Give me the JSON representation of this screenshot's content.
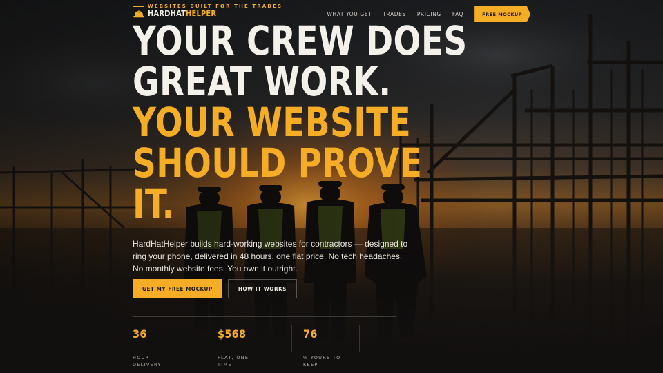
{
  "header": {
    "tagline": "WEBSITES BUILT FOR THE TRADES",
    "brand_primary": "HARDHAT",
    "brand_accent": "HELPER",
    "logo_icon": "hard-hat-icon",
    "nav": [
      {
        "label": "WHAT YOU GET"
      },
      {
        "label": "TRADES"
      },
      {
        "label": "PRICING"
      },
      {
        "label": "FAQ"
      }
    ],
    "cta_label": "FREE MOCKUP"
  },
  "hero": {
    "headline_white": [
      "YOUR CREW DOES",
      "GREAT WORK."
    ],
    "headline_accent": [
      "YOUR WEBSITE",
      "SHOULD PROVE",
      "IT."
    ],
    "lede": "HardHatHelper builds hard-working websites for contractors — designed to ring your phone, delivered in 48 hours, one flat price. No tech headaches. No monthly website fees. You own it outright.",
    "primary_button": "GET MY FREE MOCKUP",
    "secondary_button": "HOW IT WORKS"
  },
  "stats": [
    {
      "value": "36",
      "label": "HOUR DELIVERY"
    },
    {
      "value": "$568",
      "label": "FLAT, ONE TIME"
    },
    {
      "value": "76",
      "label": "% YOURS TO KEEP"
    }
  ],
  "colors": {
    "accent": "#f5ad26",
    "background": "#141211",
    "text_light": "#f4f1eb"
  }
}
